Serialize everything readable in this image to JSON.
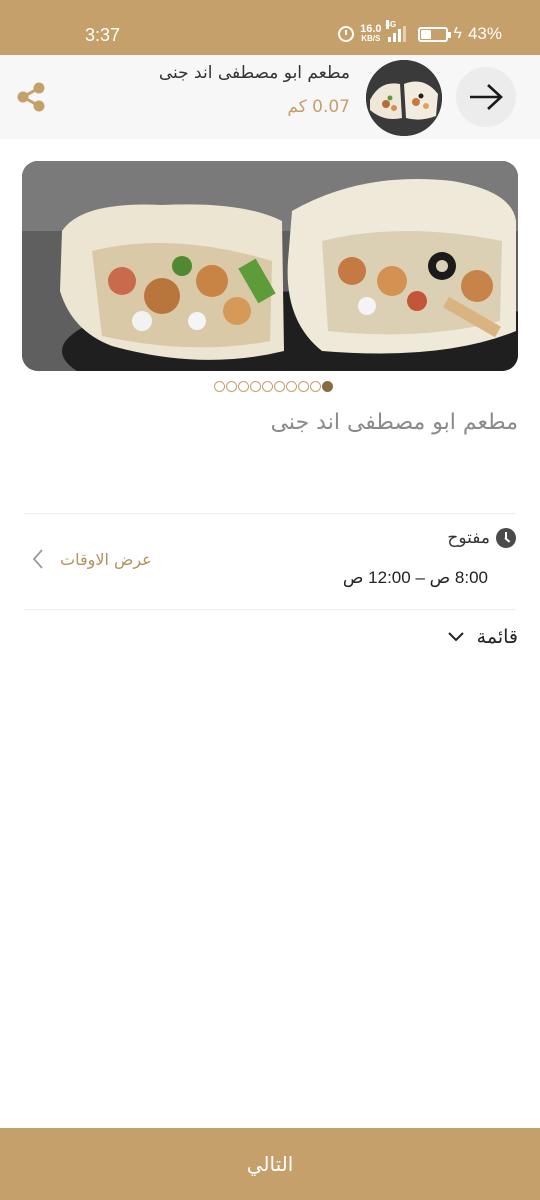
{
  "status_bar": {
    "time": "3:37",
    "net_speed": "16.0",
    "net_unit": "KB/S",
    "network": "4G",
    "battery": "43%"
  },
  "header": {
    "restaurant_name": "مطعم ابو مصطفى اند جنى",
    "distance": "0.07 كم"
  },
  "gallery": {
    "image_count": 10,
    "active_index": 9
  },
  "main": {
    "title": "مطعم ابو مصطفى اند جنى"
  },
  "hours": {
    "status": "مفتوح",
    "range": "8:00 ص – 12:00 ص",
    "show_times_label": "عرض الاوقات"
  },
  "menu": {
    "label": "قائمة"
  },
  "footer": {
    "next_label": "التالي"
  },
  "colors": {
    "accent": "#c6a06a",
    "accent_dark": "#8a6a45"
  }
}
